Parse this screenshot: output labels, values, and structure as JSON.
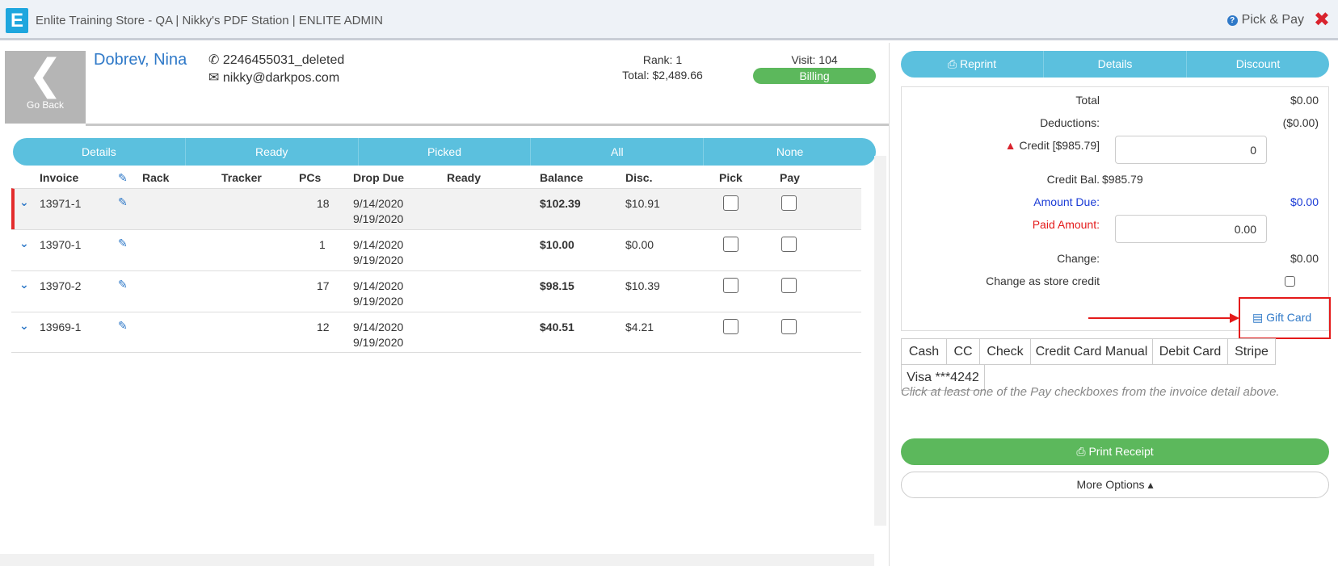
{
  "header": {
    "logo": "E",
    "title": "Enlite Training Store - QA | Nikky's PDF Station | ENLITE ADMIN",
    "help_label": "Pick & Pay",
    "close": "✖"
  },
  "customer": {
    "go_back": "Go Back",
    "name": "Dobrev, Nina",
    "phone": "2246455031_deleted",
    "email": "nikky@darkpos.com",
    "rank": "Rank: 1",
    "total": "Total: $2,489.66",
    "visit": "Visit: 104",
    "status": "Billing"
  },
  "filters": [
    "Details",
    "Ready",
    "Picked",
    "All",
    "None"
  ],
  "table": {
    "headers": [
      "Invoice",
      "Rack",
      "Tracker",
      "PCs",
      "Drop Due",
      "Ready",
      "Balance",
      "Disc.",
      "Pick",
      "Pay"
    ],
    "rows": [
      {
        "invoice": "13971-1",
        "pcs": "18",
        "drop": "9/14/2020",
        "due": "9/19/2020",
        "balance": "$102.39",
        "disc": "$10.91"
      },
      {
        "invoice": "13970-1",
        "pcs": "1",
        "drop": "9/14/2020",
        "due": "9/19/2020",
        "balance": "$10.00",
        "disc": "$0.00"
      },
      {
        "invoice": "13970-2",
        "pcs": "17",
        "drop": "9/14/2020",
        "due": "9/19/2020",
        "balance": "$98.15",
        "disc": "$10.39"
      },
      {
        "invoice": "13969-1",
        "pcs": "12",
        "drop": "9/14/2020",
        "due": "9/19/2020",
        "balance": "$40.51",
        "disc": "$4.21"
      }
    ]
  },
  "right": {
    "buttons": [
      "Reprint",
      "Details",
      "Discount"
    ],
    "total_label": "Total",
    "total_value": "$0.00",
    "deductions_label": "Deductions:",
    "deductions_value": "($0.00)",
    "credit_label": "Credit [$985.79]",
    "credit_input": "0",
    "credit_bal_label": "Credit Bal.",
    "credit_bal_value": "$985.79",
    "amount_due_label": "Amount Due:",
    "amount_due_value": "$0.00",
    "paid_label": "Paid Amount:",
    "paid_input": "0.00",
    "change_label": "Change:",
    "change_value": "$0.00",
    "store_credit_label": "Change as store credit",
    "gift_card": "Gift Card",
    "pay_methods": [
      "Cash",
      "CC",
      "Check",
      "Credit Card Manual",
      "Debit Card",
      "Stripe",
      "Visa ***4242"
    ],
    "hint": "Click at least one of the Pay checkboxes from the invoice detail above.",
    "print_receipt": "Print Receipt",
    "more_options": "More Options ▴"
  }
}
